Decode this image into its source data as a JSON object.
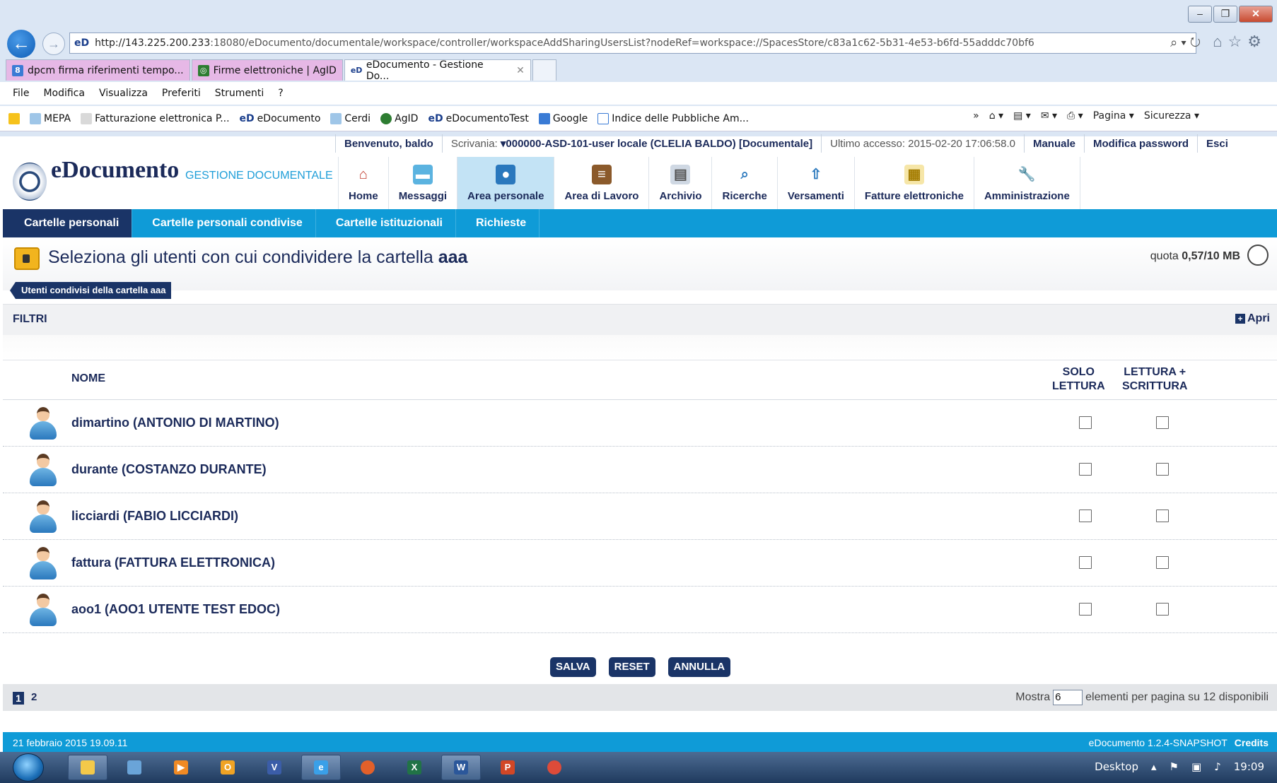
{
  "browser": {
    "url_prefix": "eD",
    "url_host": "http://143.225.200.233",
    "url_rest": ":18080/eDocumento/documentale/workspace/controller/workspaceAddSharingUsersList?nodeRef=workspace://SpacesStore/c83a1c62-5b31-4e53-b6fd-55adddc70bf6",
    "tabs": [
      {
        "label": "dpcm firma riferimenti tempo...",
        "color": "#e6b8e6"
      },
      {
        "label": "Firme elettroniche | AgID",
        "color": "#e6b8e6"
      },
      {
        "label": "eDocumento - Gestione Do...",
        "active": true
      }
    ],
    "menu": [
      "File",
      "Modifica",
      "Visualizza",
      "Preferiti",
      "Strumenti",
      "?"
    ],
    "favorites": [
      "MEPA",
      "Fatturazione elettronica P...",
      "eDocumento",
      "Cerdi",
      "AgID",
      "eDocumentoTest",
      "Google",
      "Indice delle Pubbliche Am..."
    ],
    "toolbar_right": [
      "Pagina ▾",
      "Sicurezza ▾"
    ]
  },
  "app": {
    "brand": "eDocumento",
    "brand_sub": "GESTIONE DOCUMENTALE",
    "info": {
      "welcome": "Benvenuto, baldo",
      "scrivania_label": "Scrivania:",
      "scrivania_value": "▾000000-ASD-101-user locale (CLELIA BALDO) [Documentale]",
      "last_access": "Ultimo accesso: 2015-02-20 17:06:58.0",
      "manuale": "Manuale",
      "modifica_password": "Modifica password",
      "esci": "Esci"
    },
    "modules": [
      {
        "label": "Home",
        "icon": "home-icon"
      },
      {
        "label": "Messaggi",
        "icon": "chat-icon"
      },
      {
        "label": "Area personale",
        "icon": "person-icon",
        "active": true
      },
      {
        "label": "Area di Lavoro",
        "icon": "desk-icon"
      },
      {
        "label": "Archivio",
        "icon": "cabinet-icon"
      },
      {
        "label": "Ricerche",
        "icon": "search-icon"
      },
      {
        "label": "Versamenti",
        "icon": "upload-icon"
      },
      {
        "label": "Fatture elettroniche",
        "icon": "invoice-icon"
      },
      {
        "label": "Amministrazione",
        "icon": "wrench-icon"
      }
    ],
    "subnav": [
      "Cartelle personali",
      "Cartelle personali condivise",
      "Cartelle istituzionali",
      "Richieste"
    ],
    "page_title_prefix": "Seleziona gli utenti con cui condividere la cartella",
    "page_title_folder": "aaa",
    "quota_label": "quota",
    "quota_value": "0,57/10 MB",
    "breadcrumb": "Utenti condivisi della cartella aaa",
    "filters_label": "FILTRI",
    "filters_open": "Apri",
    "columns": {
      "nome": "NOME",
      "solo_lettura_1": "SOLO",
      "solo_lettura_2": "LETTURA",
      "rw_1": "LETTURA +",
      "rw_2": "SCRITTURA"
    },
    "users": [
      {
        "name": "dimartino (ANTONIO DI MARTINO)",
        "read_only": false,
        "read_write": false
      },
      {
        "name": "durante (COSTANZO DURANTE)",
        "read_only": false,
        "read_write": false
      },
      {
        "name": "licciardi (FABIO LICCIARDI)",
        "read_only": false,
        "read_write": false
      },
      {
        "name": "fattura (FATTURA ELETTRONICA)",
        "read_only": false,
        "read_write": false
      },
      {
        "name": "aoo1 (AOO1 UTENTE TEST EDOC)",
        "read_only": false,
        "read_write": false
      }
    ],
    "buttons": {
      "save": "SALVA",
      "reset": "RESET",
      "cancel": "ANNULLA"
    },
    "pager": {
      "page1": "1",
      "page2": "2",
      "show_label": "Mostra",
      "per_page": "6",
      "show_suffix": "elementi per pagina su 12 disponibili"
    },
    "footer": {
      "date": "21 febbraio 2015 19.09.11",
      "version": "eDocumento 1.2.4-SNAPSHOT",
      "credits": "Credits"
    }
  },
  "taskbar": {
    "desktop_label": "Desktop",
    "clock": "19:09"
  }
}
